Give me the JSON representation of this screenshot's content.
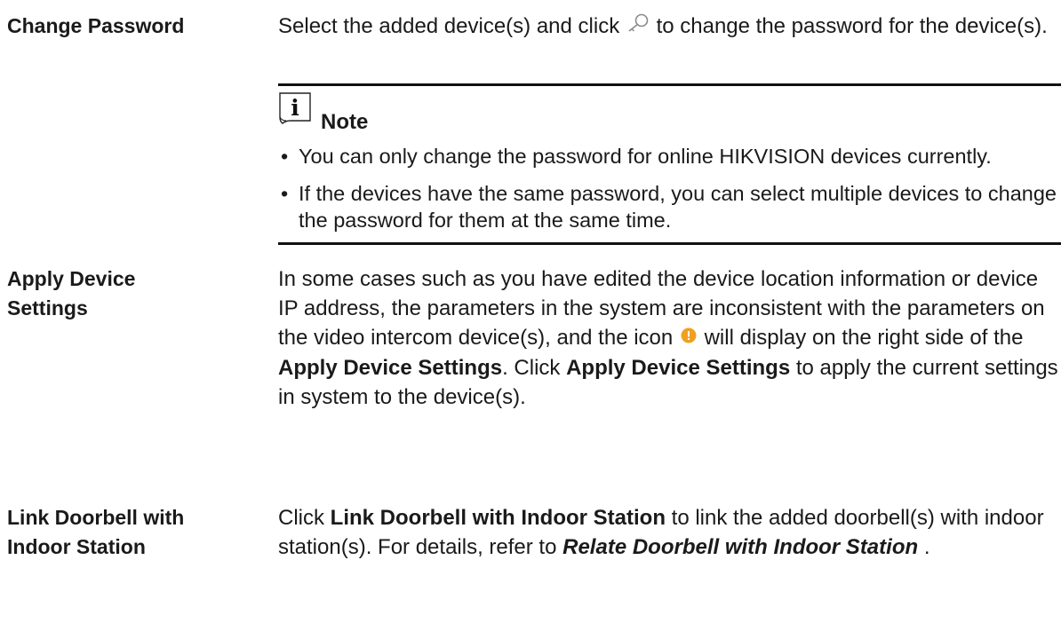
{
  "rows": [
    {
      "term": "Change Password",
      "desc": {
        "part1": "Select the added device(s) and click",
        "icon": "key-icon",
        "part2": "to change the password for the device(s)."
      }
    },
    {
      "term_line1": "Apply Device",
      "term_line2": "Settings",
      "desc": {
        "part1": "In some cases such as you have edited the device location information or device IP address, the parameters in the system are inconsistent with the parameters on the video intercom device(s), and the icon",
        "icon": "warning-dot-icon",
        "part2": "will display on the right side of the",
        "bold1": "Apply Device Settings",
        "part3": ". Click",
        "bold2": "Apply Device Settings",
        "part4": "to apply the current settings in system to the device(s)."
      }
    },
    {
      "term_line1": "Link Doorbell with",
      "term_line2": "Indoor Station",
      "desc": {
        "part1": "Click",
        "bold1": "Link Doorbell with Indoor Station",
        "part2": "to link the added doorbell(s) with indoor station(s). For details, refer to",
        "link": "Relate Doorbell with Indoor Station",
        "part3": "."
      }
    }
  ],
  "note": {
    "icon": "info-book-icon",
    "title": "Note",
    "items": [
      "You can only change the password for online HIKVISION devices currently.",
      "If the devices have the same password, you can select multiple devices to change the password for them at the same time."
    ]
  },
  "colors": {
    "text": "#1a1a1a",
    "warning_icon": "#f0a020"
  }
}
